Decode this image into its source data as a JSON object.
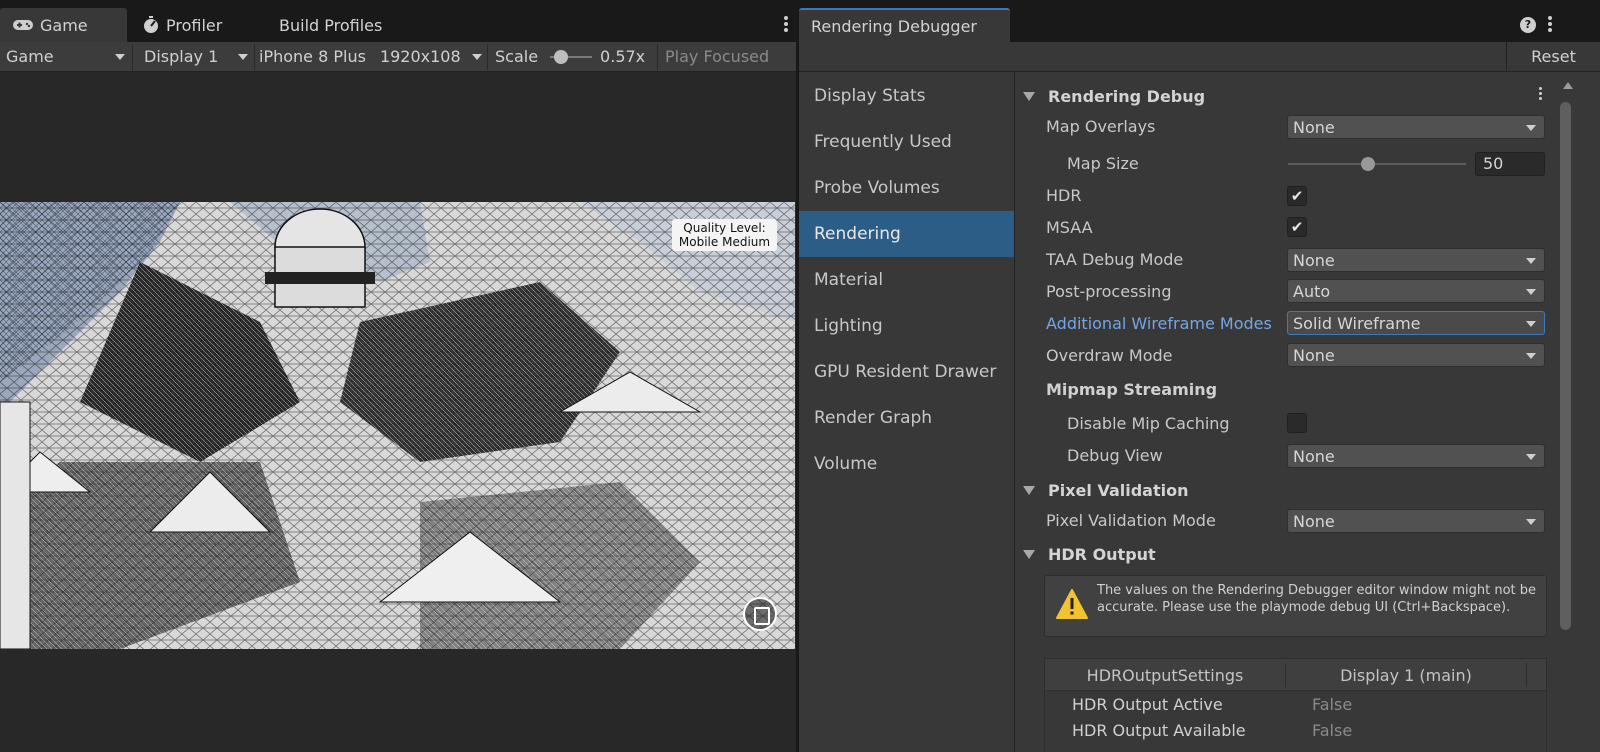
{
  "game_window": {
    "tabs": [
      {
        "label": "Game",
        "icon": "gamepad-icon",
        "active": true
      },
      {
        "label": "Profiler",
        "icon": "profiler-icon",
        "active": false
      },
      {
        "label": "Build Profiles",
        "active": false
      }
    ],
    "toolbar": {
      "view_mode": "Game",
      "display": "Display 1",
      "device": "iPhone 8 Plus",
      "resolution": "1920x108",
      "scale_label": "Scale",
      "scale_value": "0.57x",
      "scale_fraction": 0.15,
      "play_focused": "Play Focused"
    },
    "quality_label": "Quality Level:\nMobile Medium"
  },
  "debugger": {
    "tab_title": "Rendering Debugger",
    "reset_label": "Reset",
    "categories": [
      {
        "label": "Display Stats",
        "selected": false
      },
      {
        "label": "Frequently Used",
        "selected": false
      },
      {
        "label": "Probe Volumes",
        "selected": false
      },
      {
        "label": "Rendering",
        "selected": true
      },
      {
        "label": "Material",
        "selected": false
      },
      {
        "label": "Lighting",
        "selected": false
      },
      {
        "label": "GPU Resident Drawer",
        "selected": false
      },
      {
        "label": "Render Graph",
        "selected": false
      },
      {
        "label": "Volume",
        "selected": false
      }
    ],
    "rendering_debug": {
      "title": "Rendering Debug",
      "map_overlays": {
        "label": "Map Overlays",
        "value": "None"
      },
      "map_size": {
        "label": "Map Size",
        "value": "50",
        "fraction": 0.45
      },
      "hdr": {
        "label": "HDR",
        "checked": true
      },
      "msaa": {
        "label": "MSAA",
        "checked": true
      },
      "taa_debug_mode": {
        "label": "TAA Debug Mode",
        "value": "None"
      },
      "post_processing": {
        "label": "Post-processing",
        "value": "Auto"
      },
      "wireframe_modes": {
        "label": "Additional Wireframe Modes",
        "value": "Solid Wireframe"
      },
      "overdraw_mode": {
        "label": "Overdraw Mode",
        "value": "None"
      },
      "mipmap_streaming": {
        "title": "Mipmap Streaming",
        "disable_mip_caching": {
          "label": "Disable Mip Caching",
          "checked": false
        },
        "debug_view": {
          "label": "Debug View",
          "value": "None"
        }
      }
    },
    "pixel_validation": {
      "title": "Pixel Validation",
      "mode": {
        "label": "Pixel Validation Mode",
        "value": "None"
      }
    },
    "hdr_output": {
      "title": "HDR Output",
      "warning": "The values on the Rendering Debugger editor window might not be accurate. Please use the playmode debug UI (Ctrl+Backspace).",
      "table": {
        "columns": [
          "HDROutputSettings",
          "Display 1 (main)"
        ],
        "rows": [
          {
            "label": "HDR Output Active",
            "value": "False"
          },
          {
            "label": "HDR Output Available",
            "value": "False"
          }
        ]
      }
    }
  }
}
